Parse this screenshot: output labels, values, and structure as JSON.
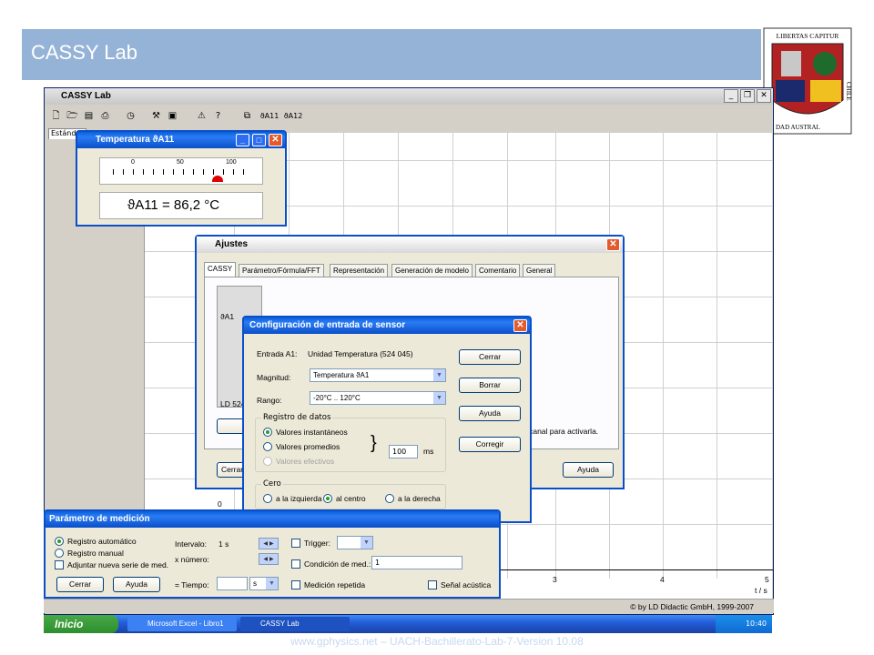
{
  "slide": {
    "title": "CASSY Lab",
    "footer": "www.gphysics.net – UACH-Bachillerato-Lab-7-Version 10.08",
    "logo_top_text": "LIBERTAS CAPITUR",
    "logo_bottom_text": "DAD AUSTRAL",
    "logo_side_text": "CHILE"
  },
  "app": {
    "title": "CASSY Lab",
    "tab_label": "Estánd",
    "status": "© by LD Didactic GmbH, 1999-2007",
    "axis_x_ticks": [
      "3",
      "4",
      "5"
    ],
    "axis_x_label": "t / s",
    "axis_y_zero": "0",
    "toolbar_channel_1": "ϑA11",
    "toolbar_channel_2": "ϑA12"
  },
  "temperature_window": {
    "title": "Temperatura ϑA11",
    "scale_labels": [
      "0",
      "50",
      "100"
    ],
    "readout_symbol": "ϑA11 =",
    "readout_value": "86,2 °C",
    "pointer_fraction": 0.86
  },
  "ajustes": {
    "title": "Ajustes",
    "tabs": [
      "CASSY",
      "Parámetro/Fórmula/FFT",
      "Representación",
      "Generación de modelo",
      "Comentario",
      "General"
    ],
    "channel_label": "ϑA1",
    "device_label": "LD 524",
    "hint_text": "n canal para activarla.",
    "close_label": "Cerrar",
    "help_label": "Ayuda"
  },
  "sensor_dialog": {
    "title": "Configuración de entrada de sensor",
    "input_label": "Entrada A1:",
    "input_value": "Unidad Temperatura (524 045)",
    "magnitude_label": "Magnitud:",
    "magnitude_value": "Temperatura ϑA1",
    "range_label": "Rango:",
    "range_value": "-20°C .. 120°C",
    "data_group": "Registro de datos",
    "data_options": [
      "Valores instantáneos",
      "Valores promedios",
      "Valores efectivos"
    ],
    "average_value": "100",
    "average_unit": "ms",
    "zero_group": "Cero",
    "zero_options": [
      "a la izquierda",
      "al centro",
      "a la derecha"
    ],
    "buttons": [
      "Cerrar",
      "Borrar",
      "Ayuda",
      "Corregir"
    ]
  },
  "measure_window": {
    "title": "Parámetro de medición",
    "mode_options": [
      "Registro automático",
      "Registro manual"
    ],
    "append_label": "Adjuntar nueva serie de med.",
    "interval_label": "Intervalo:",
    "interval_value": "1 s",
    "count_label": "x número:",
    "time_label": "= Tiempo:",
    "time_unit": "s",
    "trigger_label": "Trigger:",
    "condition_label": "Condición de med.:",
    "condition_value": "1",
    "repeat_label": "Medición repetida",
    "acoustic_label": "Señal acústica",
    "close_label": "Cerrar",
    "help_label": "Ayuda"
  },
  "taskbar": {
    "start": "Inicio",
    "tasks": [
      "Microsoft Excel - Libro1",
      "CASSY Lab"
    ],
    "clock": "10:40"
  }
}
